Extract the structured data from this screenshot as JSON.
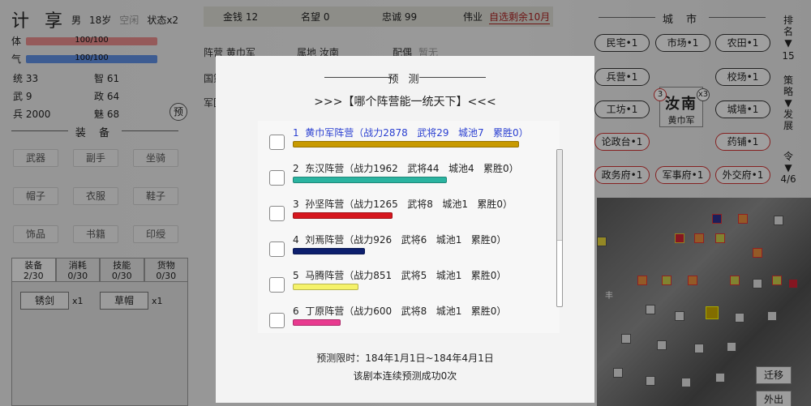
{
  "character": {
    "name": "计 享",
    "gender": "男",
    "age": "18岁",
    "status_idle": "空闲",
    "status_x": "状态x2",
    "hp_label": "体",
    "hp_value": "100/100",
    "qi_label": "气",
    "qi_value": "100/100",
    "attrs": [
      {
        "label": "统",
        "value": "33"
      },
      {
        "label": "智",
        "value": "61"
      },
      {
        "label": "武",
        "value": "9"
      },
      {
        "label": "政",
        "value": "64"
      },
      {
        "label": "兵",
        "value": "2000"
      },
      {
        "label": "魅",
        "value": "68"
      }
    ],
    "predict_btn": "预",
    "equip_title": "装 备",
    "equip_slots": [
      "武器",
      "副手",
      "坐骑",
      "帽子",
      "衣服",
      "鞋子",
      "饰品",
      "书籍",
      "印绶"
    ]
  },
  "inventory": {
    "tabs": [
      {
        "label": "装备",
        "count": "2/30"
      },
      {
        "label": "消耗",
        "count": "0/30"
      },
      {
        "label": "技能",
        "count": "0/30"
      },
      {
        "label": "货物",
        "count": "0/30"
      }
    ],
    "items": [
      {
        "name": "锈剑",
        "qty": "x1"
      },
      {
        "name": "草帽",
        "qty": "x1"
      }
    ]
  },
  "topbar": {
    "gold": "金钱 12",
    "fame": "名望 0",
    "loyalty": "忠诚 99",
    "feat_label": "伟业",
    "feat_value": "自选剩余10月"
  },
  "background": {
    "faction": "阵营 黄巾军",
    "territory": "属地 汝南",
    "spouse_label": "配偶",
    "spouse_value": "暂无",
    "frag1": "国策",
    "frag2": "军团"
  },
  "city": {
    "title": "城 市",
    "buildings": [
      "民宅•1",
      "市场•1",
      "农田•1",
      "兵营•1",
      "校场•1",
      "工坊•1",
      "城墙•1",
      "论政台•1",
      "药铺•1",
      "政务府•1",
      "军事府•1",
      "外交府•1"
    ],
    "city_name": "汝南",
    "city_owner": "黄巾军",
    "badge_left": "3",
    "badge_right": "x3"
  },
  "side_nav": {
    "rank": "排名▼",
    "rank_value": "15",
    "strategy": "策略▼发展",
    "orders": "令▼",
    "orders_value": "4/6"
  },
  "map_buttons": {
    "move": "迁移",
    "out": "外出",
    "map_marker": "丰"
  },
  "modal": {
    "title": "预 测",
    "question": ">>>【哪个阵营能一统天下】<<<",
    "factions": [
      {
        "text": "1  黄巾军阵营（战力2878   武将29   城池7   累胜0）",
        "bar_pct": 100,
        "color": "#c89a00",
        "text_color": "#2a3fd1"
      },
      {
        "text": "2  东汉阵营（战力1962   武将44   城池4   累胜0）",
        "bar_pct": 68,
        "color": "#2ab3a0",
        "text_color": "#222222"
      },
      {
        "text": "3  孙坚阵营（战力1265   武将8   城池1   累胜0）",
        "bar_pct": 44,
        "color": "#d6161e",
        "text_color": "#222222"
      },
      {
        "text": "4  刘焉阵营（战力926   武将6   城池1   累胜0）",
        "bar_pct": 32,
        "color": "#0d1f6e",
        "text_color": "#222222"
      },
      {
        "text": "5  马腾阵营（战力851   武将5   城池1   累胜0）",
        "bar_pct": 29,
        "color": "#f5f26a",
        "text_color": "#222222"
      },
      {
        "text": "6  丁原阵营（战力600   武将8   城池1   累胜0）",
        "bar_pct": 21,
        "color": "#e83a8f",
        "text_color": "#222222"
      }
    ],
    "deadline": "预测限时：184年1月1日~184年4月1日",
    "streak": "该剧本连续预测成功0次"
  }
}
